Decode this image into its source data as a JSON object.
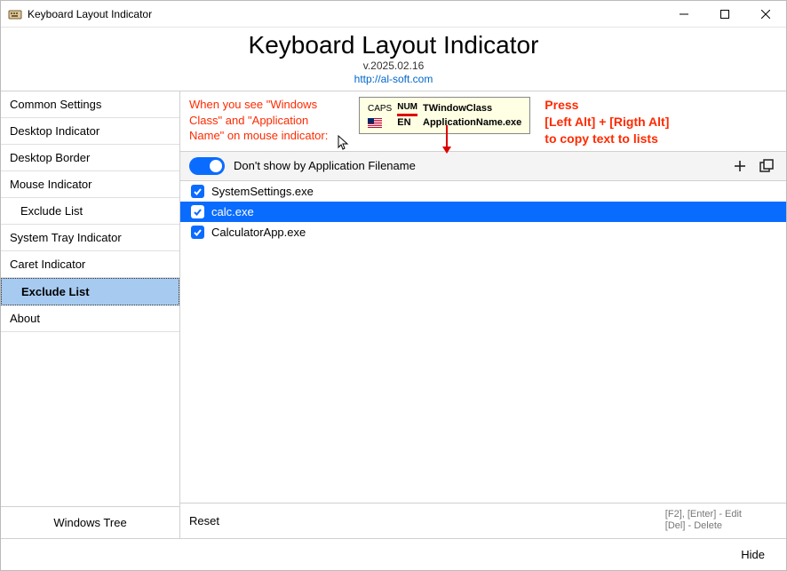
{
  "window": {
    "title": "Keyboard Layout Indicator"
  },
  "header": {
    "title": "Keyboard Layout Indicator",
    "version": "v.2025.02.16",
    "link": "http://al-soft.com"
  },
  "sidebar": {
    "items": [
      {
        "label": "Common Settings",
        "indent": false,
        "selected": false
      },
      {
        "label": "Desktop Indicator",
        "indent": false,
        "selected": false
      },
      {
        "label": "Desktop Border",
        "indent": false,
        "selected": false
      },
      {
        "label": "Mouse Indicator",
        "indent": false,
        "selected": false
      },
      {
        "label": "Exclude List",
        "indent": true,
        "selected": false
      },
      {
        "label": "System Tray Indicator",
        "indent": false,
        "selected": false
      },
      {
        "label": "Caret Indicator",
        "indent": false,
        "selected": false
      },
      {
        "label": "Exclude List",
        "indent": true,
        "selected": true
      },
      {
        "label": "About",
        "indent": false,
        "selected": false
      }
    ],
    "footer": "Windows Tree"
  },
  "hint": {
    "left": "When you see \"Windows Class\" and \"Application Name\" on mouse indicator:",
    "tooltip": {
      "caps": "CAPS",
      "num": "NUM",
      "class": "TWindowClass",
      "app": "ApplicationName.exe",
      "lang": "EN"
    },
    "right_l1": "Press",
    "right_l2": "[Left Alt] + [Rigth Alt]",
    "right_l3": "to copy text to lists"
  },
  "toggle": {
    "on": true,
    "label": "Don't show by Application Filename"
  },
  "list": [
    {
      "label": "SystemSettings.exe",
      "checked": true,
      "selected": false
    },
    {
      "label": "calc.exe",
      "checked": true,
      "selected": true
    },
    {
      "label": "CalculatorApp.exe",
      "checked": true,
      "selected": false
    }
  ],
  "footer": {
    "reset": "Reset",
    "hint1": "[F2], [Enter] - Edit",
    "hint2": "[Del] - Delete"
  },
  "bottom": {
    "hide": "Hide"
  }
}
